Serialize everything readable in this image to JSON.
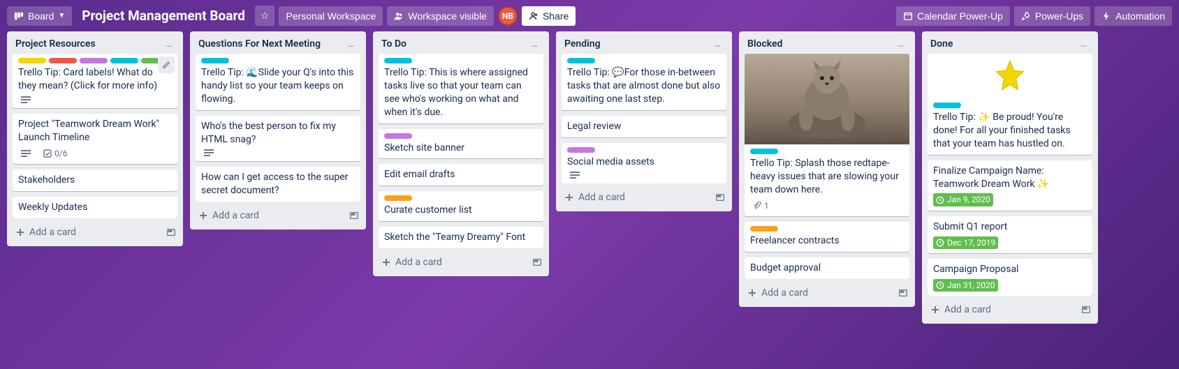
{
  "header": {
    "board_btn_label": "Board",
    "title": "Project Management Board",
    "workspace_label": "Personal Workspace",
    "visibility_label": "Workspace visible",
    "share_label": "Share",
    "avatar_initials": "NB",
    "calendar_btn": "Calendar Power-Up",
    "powerups_btn": "Power-Ups",
    "automation_btn": "Automation"
  },
  "colors": {
    "yellow": "#f2d600",
    "red": "#eb5a46",
    "purple": "#c377e0",
    "teal": "#00c2e0",
    "green": "#61bd4f",
    "orange": "#ff9f1a"
  },
  "ui": {
    "add_card": "Add a card",
    "list_menu": "…"
  },
  "lists": [
    {
      "title": "Project Resources",
      "cards": [
        {
          "labels": [
            "yellow",
            "red",
            "purple",
            "teal",
            "green"
          ],
          "title": "Trello Tip: Card labels! What do they mean? (Click for more info)",
          "badges": {
            "desc": true
          },
          "pencil": true
        },
        {
          "title": "Project \"Teamwork Dream Work\" Launch Timeline",
          "badges": {
            "desc": true,
            "checklist": "0/6"
          }
        },
        {
          "title": "Stakeholders"
        },
        {
          "title": "Weekly Updates"
        }
      ]
    },
    {
      "title": "Questions For Next Meeting",
      "cards": [
        {
          "labels": [
            "teal"
          ],
          "title": "Trello Tip: 🌊Slide your Q's into this handy list so your team keeps on flowing."
        },
        {
          "title": "Who's the best person to fix my HTML snag?",
          "badges": {
            "desc": true
          }
        },
        {
          "title": "How can I get access to the super secret document?"
        }
      ]
    },
    {
      "title": "To Do",
      "cards": [
        {
          "labels": [
            "teal"
          ],
          "title": "Trello Tip: This is where assigned tasks live so that your team can see who's working on what and when it's due."
        },
        {
          "labels": [
            "purple"
          ],
          "title": "Sketch site banner"
        },
        {
          "title": "Edit email drafts"
        },
        {
          "labels": [
            "orange"
          ],
          "title": "Curate customer list"
        },
        {
          "title": "Sketch the \"Teamy Dreamy\" Font"
        }
      ]
    },
    {
      "title": "Pending",
      "cards": [
        {
          "labels": [
            "teal"
          ],
          "title": "Trello Tip: 💬For those in-between tasks that are almost done but also awaiting one last step."
        },
        {
          "title": "Legal review"
        },
        {
          "labels": [
            "purple"
          ],
          "title": "Social media assets",
          "badges": {
            "desc": true
          }
        }
      ]
    },
    {
      "title": "Blocked",
      "cards": [
        {
          "cover": "cat",
          "labels": [
            "teal"
          ],
          "title": "Trello Tip: Splash those redtape-heavy issues that are slowing your team down here.",
          "badges": {
            "attach": "1"
          }
        },
        {
          "labels": [
            "orange"
          ],
          "title": "Freelancer contracts"
        },
        {
          "title": "Budget approval"
        }
      ]
    },
    {
      "title": "Done",
      "cards": [
        {
          "cover": "star",
          "labels": [
            "teal"
          ],
          "title": "Trello Tip: ✨ Be proud! You're done! For all your finished tasks that your team has hustled on."
        },
        {
          "title": "Finalize Campaign Name: Teamwork Dream Work ✨",
          "badges": {
            "date": "Jan 9, 2020",
            "date_green": true
          }
        },
        {
          "title": "Submit Q1 report",
          "badges": {
            "date": "Dec 17, 2019",
            "date_green": true
          }
        },
        {
          "title": "Campaign Proposal",
          "badges": {
            "date": "Jan 31, 2020",
            "date_green": true
          }
        }
      ]
    }
  ]
}
